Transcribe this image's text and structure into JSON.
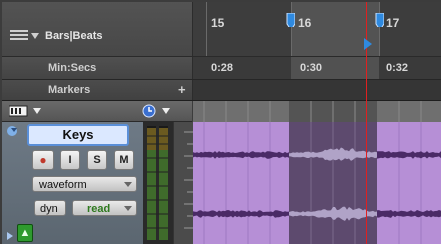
{
  "ruler": {
    "bars_label": "Bars|Beats",
    "mins_label": "Min:Secs",
    "markers_label": "Markers",
    "add_marker_glyph": "+",
    "bars": [
      "15",
      "16",
      "17"
    ],
    "times": [
      "0:28",
      "0:30",
      "0:32"
    ]
  },
  "track": {
    "name": "Keys",
    "record_glyph": "●",
    "input_label": "I",
    "solo_label": "S",
    "mute_label": "M",
    "view_mode": "waveform",
    "automation_mode": "dyn",
    "automation_state": "read",
    "voice_glyph": "▲"
  },
  "colors": {
    "clip_fill": "#b68fd6",
    "clip_selected": "#5d4a6e",
    "waveform": "#4a2a66",
    "waveform_selected": "#b0a3c7",
    "playhead": "#e02020",
    "selection_blue": "#2f8ae0",
    "read_green": "#2f7a1f"
  }
}
